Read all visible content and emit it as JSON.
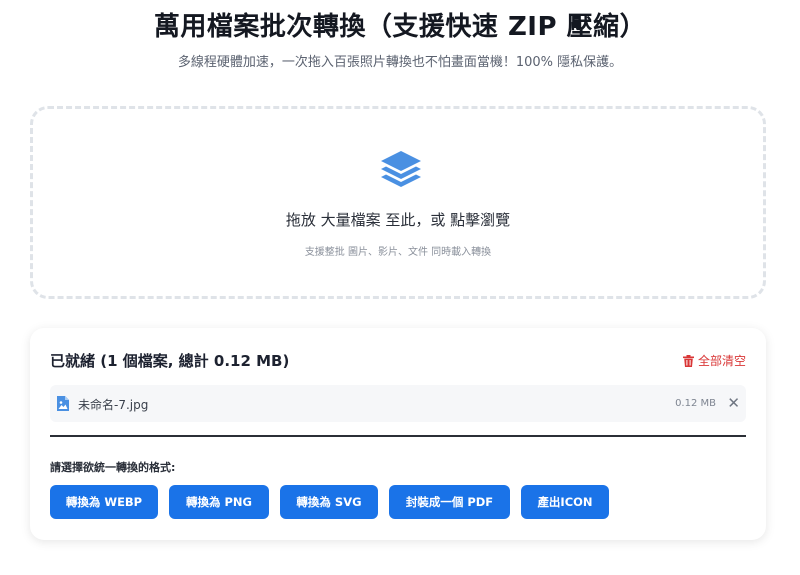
{
  "header": {
    "title": "萬用檔案批次轉換（支援快速 ZIP 壓縮）",
    "subtitle": "多線程硬體加速，一次拖入百張照片轉換也不怕畫面當機！100% 隱私保護。"
  },
  "dropzone": {
    "icon": "layers-icon",
    "main_text": "拖放 大量檔案 至此，或 點擊瀏覽",
    "sub_text": "支援整批 圖片、影片、文件 同時載入轉換"
  },
  "panel": {
    "status_title": "已就緒 (1 個檔案, 總計 0.12 MB)",
    "clear_all_label": "全部清空",
    "files": [
      {
        "name": "未命名-7.jpg",
        "size": "0.12 MB",
        "remove_label": "✕"
      }
    ],
    "format_prompt": "請選擇欲統一轉換的格式:",
    "buttons": [
      "轉換為 WEBP",
      "轉換為 PNG",
      "轉換為 SVG",
      "封裝成一個 PDF",
      "產出ICON"
    ]
  },
  "colors": {
    "accent": "#1a73e8",
    "icon_blue": "#4a90e2",
    "danger": "#d93636"
  }
}
